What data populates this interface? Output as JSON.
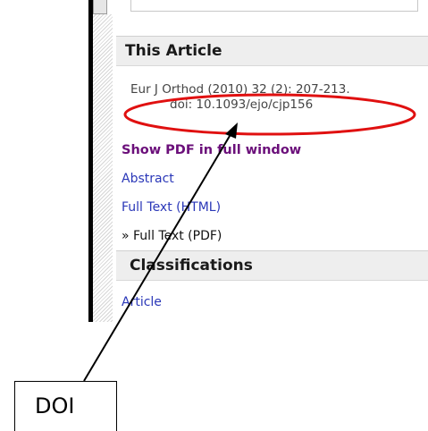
{
  "sidebar": {
    "this_article_title": "This Article",
    "citation_line1": "Eur J Orthod (2010) 32 (2): 207-213.",
    "citation_line2": "doi: 10.1093/ejo/cjp156",
    "links": {
      "show_pdf_full_window": "Show PDF in full window",
      "abstract": "Abstract",
      "full_text_html": "Full Text (HTML)",
      "full_text_pdf": "» Full Text (PDF)"
    },
    "classifications_title": "Classifications",
    "classification_links": {
      "article": "Article"
    }
  },
  "annotation": {
    "label": "DOI",
    "highlight_color": "#e01010",
    "arrow_color": "#000000"
  },
  "colors": {
    "visited_link": "#6b0f7a",
    "link": "#2a37b8",
    "section_header_bg": "#eeeeee"
  }
}
